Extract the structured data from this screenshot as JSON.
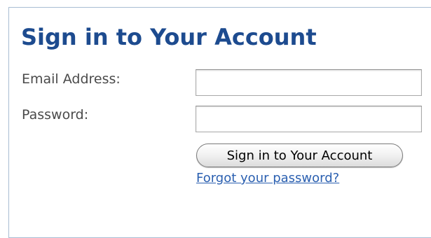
{
  "form": {
    "title": "Sign in to Your Account",
    "email_label": "Email Address:",
    "email_value": "",
    "email_placeholder": "",
    "password_label": "Password:",
    "password_value": "",
    "password_placeholder": "",
    "submit_label": "Sign in to Your Account",
    "forgot_link": "Forgot your password?"
  },
  "colors": {
    "title": "#1d4b8f",
    "label": "#4a4a4a",
    "link": "#2a5fb0",
    "panel_border": "#a8bdd3"
  }
}
